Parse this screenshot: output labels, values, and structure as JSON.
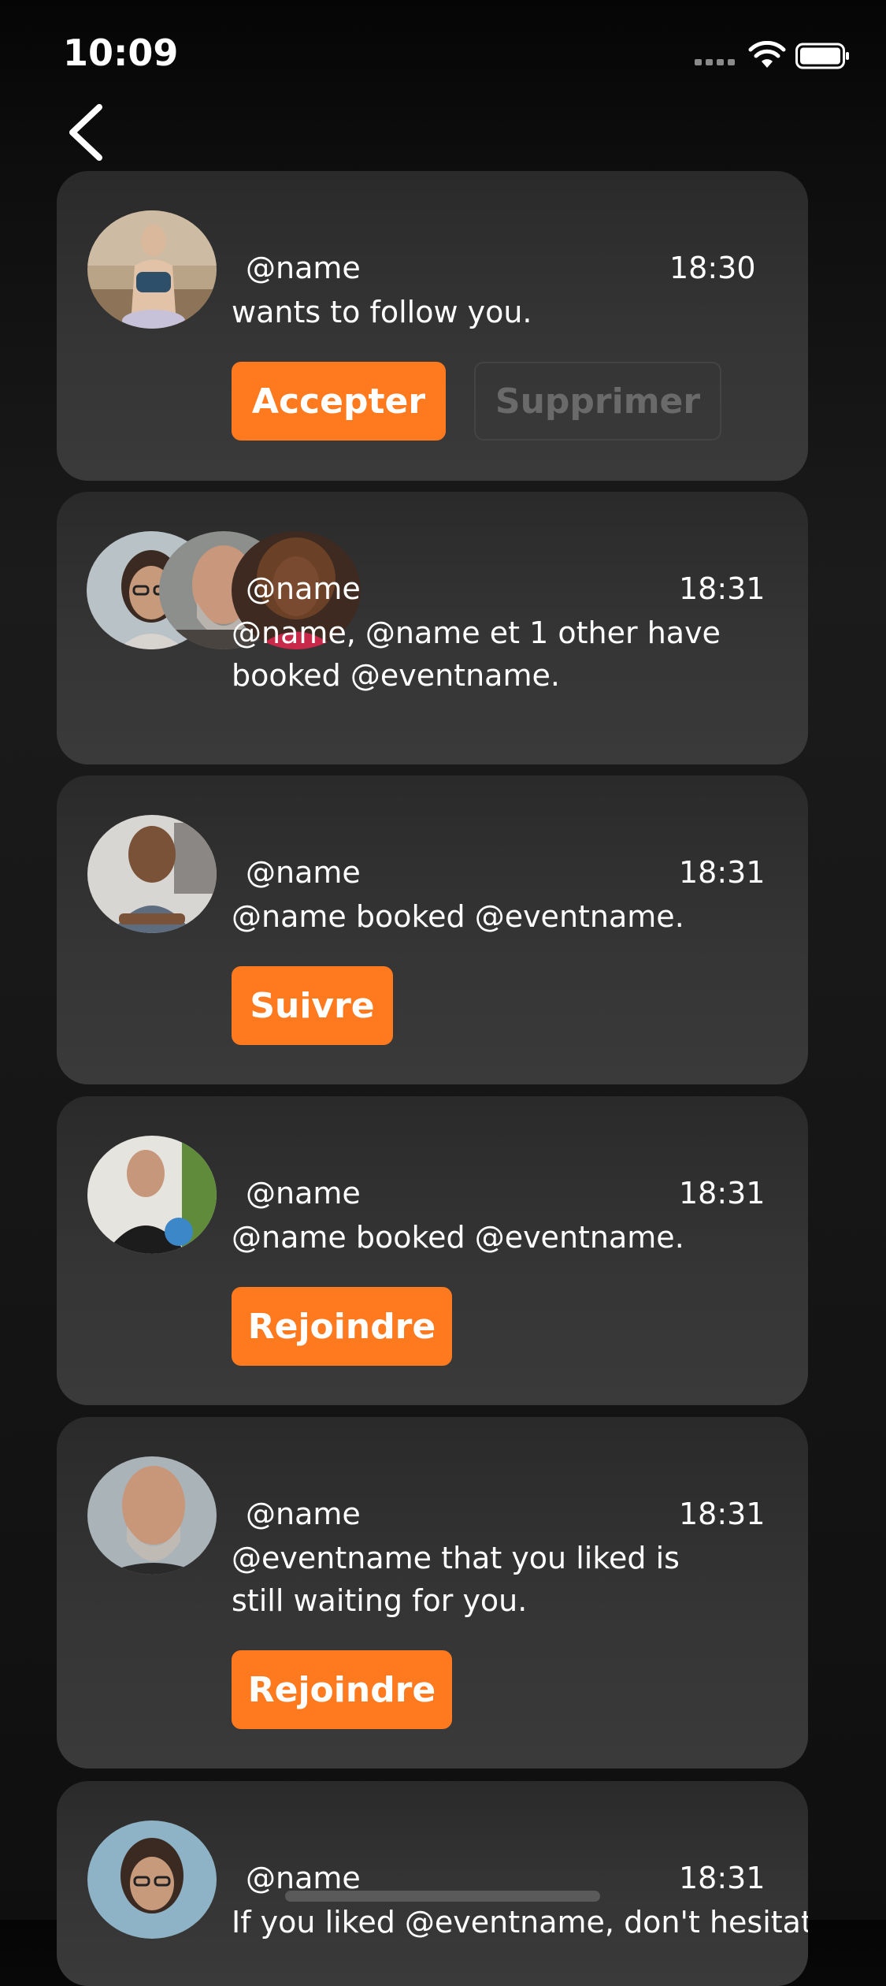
{
  "status_bar": {
    "time": "10:09"
  },
  "colors": {
    "accent": "#ff7a1f",
    "background": "#141414",
    "card": "#333333"
  },
  "notifications": [
    {
      "name": "@name",
      "time": "18:30",
      "message": "wants to follow you.",
      "buttons": [
        "Accepter",
        "Supprimer"
      ]
    },
    {
      "name": "@name",
      "time": "18:31",
      "message": "@name, @name et 1 other have booked @eventname.",
      "buttons": []
    },
    {
      "name": "@name",
      "time": "18:31",
      "message": "@name booked @eventname.",
      "buttons": [
        "Suivre"
      ]
    },
    {
      "name": "@name",
      "time": "18:31",
      "message": "@name booked @eventname.",
      "buttons": [
        "Rejoindre"
      ]
    },
    {
      "name": "@name",
      "time": "18:31",
      "message": "@eventname that you liked is still waiting for you.",
      "buttons": [
        "Rejoindre"
      ]
    },
    {
      "name": "@name",
      "time": "18:31",
      "message": "If you liked @eventname, don't hesitate to",
      "buttons": []
    }
  ]
}
